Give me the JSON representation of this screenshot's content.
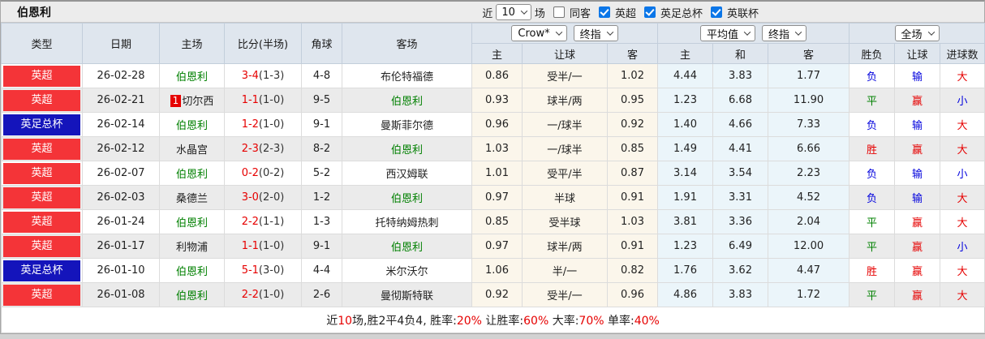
{
  "title": "伯恩利",
  "controls": {
    "recent_label": "近",
    "recent_value": "10",
    "recent_suffix": "场",
    "checkboxes": [
      {
        "label": "同客",
        "checked": false
      },
      {
        "label": "英超",
        "checked": true
      },
      {
        "label": "英足总杯",
        "checked": true
      },
      {
        "label": "英联杯",
        "checked": true
      }
    ]
  },
  "selects": {
    "bookmaker": "Crow*",
    "bookmaker_stage": "终指",
    "average": "平均值",
    "average_stage": "终指",
    "scope": "全场"
  },
  "columns": {
    "type": "类型",
    "date": "日期",
    "home": "主场",
    "score": "比分(半场)",
    "corner": "角球",
    "away": "客场",
    "crow_home": "主",
    "crow_handicap": "让球",
    "crow_away": "客",
    "avg_home": "主",
    "avg_draw": "和",
    "avg_away": "客",
    "result_wdl": "胜负",
    "result_handicap": "让球",
    "result_goals": "进球数"
  },
  "rows": [
    {
      "league": "英超",
      "league_color": "red",
      "date": "26-02-28",
      "home": "伯恩利",
      "home_self": true,
      "home_rank": null,
      "score": "3-4",
      "half": "(1-3)",
      "corner": "4-8",
      "away": "布伦特福德",
      "away_self": false,
      "crow": [
        "0.86",
        "受半/一",
        "1.02"
      ],
      "avg": [
        "4.44",
        "3.83",
        "1.77"
      ],
      "results": [
        {
          "text": "负",
          "color": "blue"
        },
        {
          "text": "输",
          "color": "blue"
        },
        {
          "text": "大",
          "color": "red"
        }
      ]
    },
    {
      "league": "英超",
      "league_color": "red",
      "date": "26-02-21",
      "home": "切尔西",
      "home_self": false,
      "home_rank": "1",
      "score": "1-1",
      "half": "(1-0)",
      "corner": "9-5",
      "away": "伯恩利",
      "away_self": true,
      "crow": [
        "0.93",
        "球半/两",
        "0.95"
      ],
      "avg": [
        "1.23",
        "6.68",
        "11.90"
      ],
      "results": [
        {
          "text": "平",
          "color": "green"
        },
        {
          "text": "赢",
          "color": "red"
        },
        {
          "text": "小",
          "color": "blue"
        }
      ]
    },
    {
      "league": "英足总杯",
      "league_color": "blue",
      "date": "26-02-14",
      "home": "伯恩利",
      "home_self": true,
      "home_rank": null,
      "score": "1-2",
      "half": "(1-0)",
      "corner": "9-1",
      "away": "曼斯菲尔德",
      "away_self": false,
      "crow": [
        "0.96",
        "一/球半",
        "0.92"
      ],
      "avg": [
        "1.40",
        "4.66",
        "7.33"
      ],
      "results": [
        {
          "text": "负",
          "color": "blue"
        },
        {
          "text": "输",
          "color": "blue"
        },
        {
          "text": "大",
          "color": "red"
        }
      ]
    },
    {
      "league": "英超",
      "league_color": "red",
      "date": "26-02-12",
      "home": "水晶宫",
      "home_self": false,
      "home_rank": null,
      "score": "2-3",
      "half": "(2-3)",
      "corner": "8-2",
      "away": "伯恩利",
      "away_self": true,
      "crow": [
        "1.03",
        "一/球半",
        "0.85"
      ],
      "avg": [
        "1.49",
        "4.41",
        "6.66"
      ],
      "results": [
        {
          "text": "胜",
          "color": "red"
        },
        {
          "text": "赢",
          "color": "red"
        },
        {
          "text": "大",
          "color": "red"
        }
      ]
    },
    {
      "league": "英超",
      "league_color": "red",
      "date": "26-02-07",
      "home": "伯恩利",
      "home_self": true,
      "home_rank": null,
      "score": "0-2",
      "half": "(0-2)",
      "corner": "5-2",
      "away": "西汉姆联",
      "away_self": false,
      "crow": [
        "1.01",
        "受平/半",
        "0.87"
      ],
      "avg": [
        "3.14",
        "3.54",
        "2.23"
      ],
      "results": [
        {
          "text": "负",
          "color": "blue"
        },
        {
          "text": "输",
          "color": "blue"
        },
        {
          "text": "小",
          "color": "blue"
        }
      ]
    },
    {
      "league": "英超",
      "league_color": "red",
      "date": "26-02-03",
      "home": "桑德兰",
      "home_self": false,
      "home_rank": null,
      "score": "3-0",
      "half": "(2-0)",
      "corner": "1-2",
      "away": "伯恩利",
      "away_self": true,
      "crow": [
        "0.97",
        "半球",
        "0.91"
      ],
      "avg": [
        "1.91",
        "3.31",
        "4.52"
      ],
      "results": [
        {
          "text": "负",
          "color": "blue"
        },
        {
          "text": "输",
          "color": "blue"
        },
        {
          "text": "大",
          "color": "red"
        }
      ]
    },
    {
      "league": "英超",
      "league_color": "red",
      "date": "26-01-24",
      "home": "伯恩利",
      "home_self": true,
      "home_rank": null,
      "score": "2-2",
      "half": "(1-1)",
      "corner": "1-3",
      "away": "托特纳姆热刺",
      "away_self": false,
      "crow": [
        "0.85",
        "受半球",
        "1.03"
      ],
      "avg": [
        "3.81",
        "3.36",
        "2.04"
      ],
      "results": [
        {
          "text": "平",
          "color": "green"
        },
        {
          "text": "赢",
          "color": "red"
        },
        {
          "text": "大",
          "color": "red"
        }
      ]
    },
    {
      "league": "英超",
      "league_color": "red",
      "date": "26-01-17",
      "home": "利物浦",
      "home_self": false,
      "home_rank": null,
      "score": "1-1",
      "half": "(1-0)",
      "corner": "9-1",
      "away": "伯恩利",
      "away_self": true,
      "crow": [
        "0.97",
        "球半/两",
        "0.91"
      ],
      "avg": [
        "1.23",
        "6.49",
        "12.00"
      ],
      "results": [
        {
          "text": "平",
          "color": "green"
        },
        {
          "text": "赢",
          "color": "red"
        },
        {
          "text": "小",
          "color": "blue"
        }
      ]
    },
    {
      "league": "英足总杯",
      "league_color": "blue",
      "date": "26-01-10",
      "home": "伯恩利",
      "home_self": true,
      "home_rank": null,
      "score": "5-1",
      "half": "(3-0)",
      "corner": "4-4",
      "away": "米尔沃尔",
      "away_self": false,
      "crow": [
        "1.06",
        "半/一",
        "0.82"
      ],
      "avg": [
        "1.76",
        "3.62",
        "4.47"
      ],
      "results": [
        {
          "text": "胜",
          "color": "red"
        },
        {
          "text": "赢",
          "color": "red"
        },
        {
          "text": "大",
          "color": "red"
        }
      ]
    },
    {
      "league": "英超",
      "league_color": "red",
      "date": "26-01-08",
      "home": "伯恩利",
      "home_self": true,
      "home_rank": null,
      "score": "2-2",
      "half": "(1-0)",
      "corner": "2-6",
      "away": "曼彻斯特联",
      "away_self": false,
      "crow": [
        "0.92",
        "受半/一",
        "0.96"
      ],
      "avg": [
        "4.86",
        "3.83",
        "1.72"
      ],
      "results": [
        {
          "text": "平",
          "color": "green"
        },
        {
          "text": "赢",
          "color": "red"
        },
        {
          "text": "大",
          "color": "red"
        }
      ]
    }
  ],
  "footer": {
    "segments": [
      {
        "text": "近",
        "red": false
      },
      {
        "text": "10",
        "red": true
      },
      {
        "text": "场,胜2平4负4, 胜率:",
        "red": false
      },
      {
        "text": "20%",
        "red": true
      },
      {
        "text": " 让胜率:",
        "red": false
      },
      {
        "text": "60%",
        "red": true
      },
      {
        "text": " 大率:",
        "red": false
      },
      {
        "text": "70%",
        "red": true
      },
      {
        "text": " 单率:",
        "red": false
      },
      {
        "text": "40%",
        "red": true
      }
    ]
  },
  "colors": {
    "league_red": "#f43438",
    "league_blue": "#1414bb",
    "score_red": "#e60000",
    "team_green": "#008000",
    "result_blue": "#0000dd",
    "header_bg": "#dfe6ee",
    "crow_tint": "#fbf6eb",
    "avg_tint": "#ebf5fa"
  }
}
